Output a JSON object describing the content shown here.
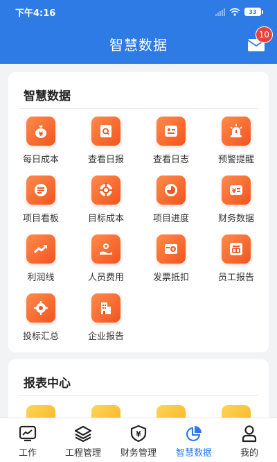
{
  "status_bar": {
    "time": "下午4:16",
    "battery": "33"
  },
  "header": {
    "title": "智慧数据",
    "mail_badge": "10"
  },
  "section_smart": {
    "title": "智慧数据",
    "items": [
      {
        "label": "每日成本",
        "icon": "money-bag-icon"
      },
      {
        "label": "查看日报",
        "icon": "report-search-icon"
      },
      {
        "label": "查看日志",
        "icon": "log-icon"
      },
      {
        "label": "预警提醒",
        "icon": "alarm-icon"
      },
      {
        "label": "项目看板",
        "icon": "board-icon"
      },
      {
        "label": "目标成本",
        "icon": "target-icon"
      },
      {
        "label": "项目进度",
        "icon": "progress-pie-icon"
      },
      {
        "label": "财务数据",
        "icon": "finance-yen-icon"
      },
      {
        "label": "利润线",
        "icon": "trend-icon"
      },
      {
        "label": "人员费用",
        "icon": "personnel-cost-icon"
      },
      {
        "label": "发票抵扣",
        "icon": "invoice-icon"
      },
      {
        "label": "员工报告",
        "icon": "staff-report-icon"
      },
      {
        "label": "投标汇总",
        "icon": "bid-summary-icon"
      },
      {
        "label": "企业报告",
        "icon": "company-report-icon"
      }
    ]
  },
  "section_reports": {
    "title": "报表中心"
  },
  "tabbar": {
    "active": "智慧数据",
    "items": [
      {
        "label": "工作",
        "icon": "work-monitor-icon"
      },
      {
        "label": "工程管理",
        "icon": "layers-icon"
      },
      {
        "label": "财务管理",
        "icon": "shield-yen-icon"
      },
      {
        "label": "智慧数据",
        "icon": "pie-chart-icon"
      },
      {
        "label": "我的",
        "icon": "user-icon"
      }
    ]
  },
  "colors": {
    "primary": "#2f7be6",
    "tile_orange": "#f2551e",
    "tile_yellow": "#f6b21a",
    "badge_red": "#e8413a"
  }
}
